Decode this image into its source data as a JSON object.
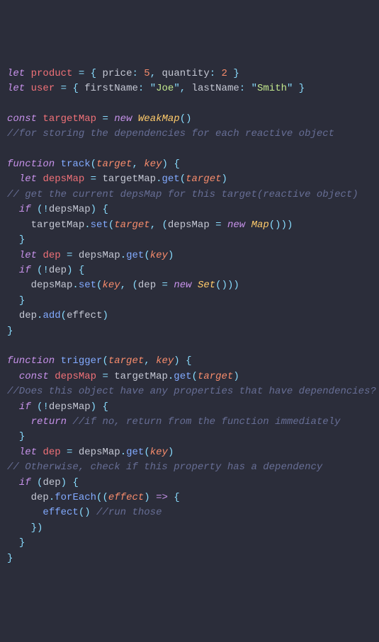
{
  "code": {
    "l1": {
      "kw_let": "let",
      "v_product": "product",
      "eq": " = ",
      "lb": "{ ",
      "p_price": "price",
      "c1": ": ",
      "n5": "5",
      "cm": ", ",
      "p_quantity": "quantity",
      "c2": ": ",
      "n2": "2",
      "rb": " }"
    },
    "l2": {
      "kw_let": "let",
      "v_user": "user",
      "eq": " = ",
      "lb": "{ ",
      "p_fn": "firstName",
      "c1": ": ",
      "q": "\"",
      "s_joe": "Joe",
      "cm": ", ",
      "p_ln": "lastName",
      "c2": ": ",
      "s_smith": "Smith",
      "rb": " }"
    },
    "l4": {
      "kw_const": "const",
      "v_tm": "targetMap",
      "eq": " = ",
      "kw_new": "new",
      "cls": "WeakMap",
      "par": "()"
    },
    "l5": {
      "cmt": "//for storing the dependencies for each reactive object"
    },
    "l7": {
      "kw_fn": "function",
      "fn": "track",
      "lp": "(",
      "p1": "target",
      "cm": ", ",
      "p2": "key",
      "rp": ") ",
      "lb": "{"
    },
    "l8": {
      "kw_let": "let",
      "v_dm": "depsMap",
      "eq": " = ",
      "v_tm": "targetMap",
      "dot": ".",
      "fn": "get",
      "lp": "(",
      "p": "target",
      "rp": ")"
    },
    "l9": {
      "cmt": "// get the current depsMap for this target(reactive object)"
    },
    "l10": {
      "kw_if": "if",
      "lp": " (",
      "not": "!",
      "v": "depsMap",
      "rp": ") ",
      "lb": "{"
    },
    "l11": {
      "v_tm": "targetMap",
      "dot": ".",
      "fn": "set",
      "lp": "(",
      "p1": "target",
      "cm": ", ",
      "lp2": "(",
      "v_dm": "depsMap",
      "eq": " = ",
      "kw_new": "new",
      "cls": "Map",
      "par": "()",
      "rp2": ")",
      "rp": ")"
    },
    "l12": {
      "rb": "}"
    },
    "l13": {
      "kw_let": "let",
      "v_dep": "dep",
      "eq": " = ",
      "v_dm": "depsMap",
      "dot": ".",
      "fn": "get",
      "lp": "(",
      "p": "key",
      "rp": ")"
    },
    "l14": {
      "kw_if": "if",
      "lp": " (",
      "not": "!",
      "v": "dep",
      "rp": ") ",
      "lb": "{"
    },
    "l15": {
      "v_dm": "depsMap",
      "dot": ".",
      "fn": "set",
      "lp": "(",
      "p1": "key",
      "cm": ", ",
      "lp2": "(",
      "v_dep": "dep",
      "eq": " = ",
      "kw_new": "new",
      "cls": "Set",
      "par": "()",
      "rp2": ")",
      "rp": ")"
    },
    "l16": {
      "rb": "}"
    },
    "l17": {
      "v_dep": "dep",
      "dot": ".",
      "fn": "add",
      "lp": "(",
      "v_e": "effect",
      "rp": ")"
    },
    "l18": {
      "rb": "}"
    },
    "l20": {
      "kw_fn": "function",
      "fn": "trigger",
      "lp": "(",
      "p1": "target",
      "cm": ", ",
      "p2": "key",
      "rp": ") ",
      "lb": "{"
    },
    "l21": {
      "kw_const": "const",
      "v_dm": "depsMap",
      "eq": " = ",
      "v_tm": "targetMap",
      "dot": ".",
      "fn": "get",
      "lp": "(",
      "p": "target",
      "rp": ")"
    },
    "l22": {
      "cmt": "//Does this object have any properties that have dependencies?"
    },
    "l23": {
      "kw_if": "if",
      "lp": " (",
      "not": "!",
      "v": "depsMap",
      "rp": ") ",
      "lb": "{"
    },
    "l24": {
      "kw_ret": "return",
      "cmt": " //if no, return from the function immediately"
    },
    "l25": {
      "rb": "}"
    },
    "l26": {
      "kw_let": "let",
      "v_dep": "dep",
      "eq": " = ",
      "v_dm": "depsMap",
      "dot": ".",
      "fn": "get",
      "lp": "(",
      "p": "key",
      "rp": ")"
    },
    "l27": {
      "cmt": "// Otherwise, check if this property has a dependency"
    },
    "l28": {
      "kw_if": "if",
      "lp": " (",
      "v": "dep",
      "rp": ") ",
      "lb": "{"
    },
    "l29": {
      "v_dep": "dep",
      "dot": ".",
      "fn": "forEach",
      "lp": "((",
      "p": "effect",
      "rp": ")",
      "arr": " => ",
      "lb": "{"
    },
    "l30": {
      "fn": "effect",
      "par": "()",
      "cmt": " //run those"
    },
    "l31": {
      "rb": "})"
    },
    "l32": {
      "rb": "}"
    },
    "l33": {
      "rb": "}"
    }
  }
}
